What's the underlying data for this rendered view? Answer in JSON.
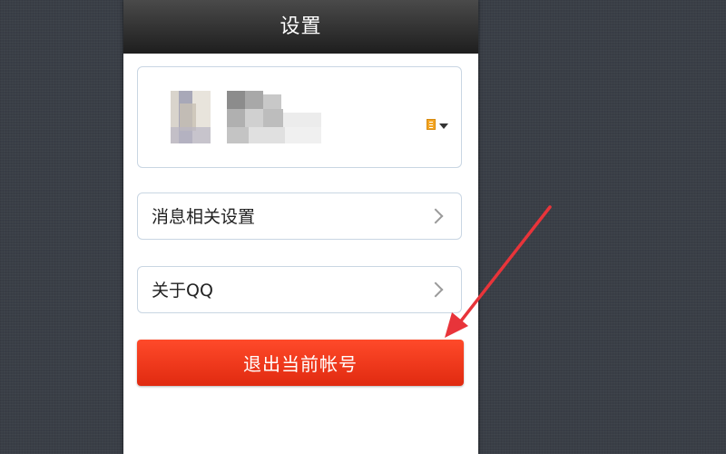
{
  "header": {
    "title": "设置"
  },
  "profile": {
    "status_icon": "status-list-icon"
  },
  "menu": {
    "items": [
      {
        "label": "消息相关设置"
      },
      {
        "label": "关于QQ"
      }
    ]
  },
  "logout": {
    "label": "退出当前帐号"
  },
  "colors": {
    "titlebar": "#2a2a2a",
    "logout_button": "#e8321a",
    "card_border": "#c9d6e3",
    "background": "#3a3f47",
    "annotation_arrow": "#e8343a"
  }
}
